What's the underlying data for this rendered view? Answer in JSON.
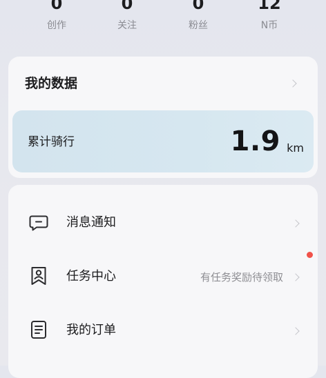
{
  "stats": [
    {
      "value": "0",
      "label": "创作"
    },
    {
      "value": "0",
      "label": "关注"
    },
    {
      "value": "0",
      "label": "粉丝"
    },
    {
      "value": "12",
      "label": "N币"
    }
  ],
  "my_data": {
    "title": "我的数据",
    "ride_label": "累计骑行",
    "ride_value": "1.9",
    "ride_unit": "km"
  },
  "menu": {
    "items": [
      {
        "label": "消息通知",
        "icon": "message-icon",
        "hint": ""
      },
      {
        "label": "任务中心",
        "icon": "task-icon",
        "hint": "有任务奖励待领取"
      },
      {
        "label": "我的订单",
        "icon": "order-icon",
        "hint": ""
      }
    ]
  },
  "colors": {
    "background": "#e7e8ee",
    "card": "#f7f7f9",
    "ride_panel": "#d6e7f0",
    "notification_dot": "#f0524a"
  }
}
